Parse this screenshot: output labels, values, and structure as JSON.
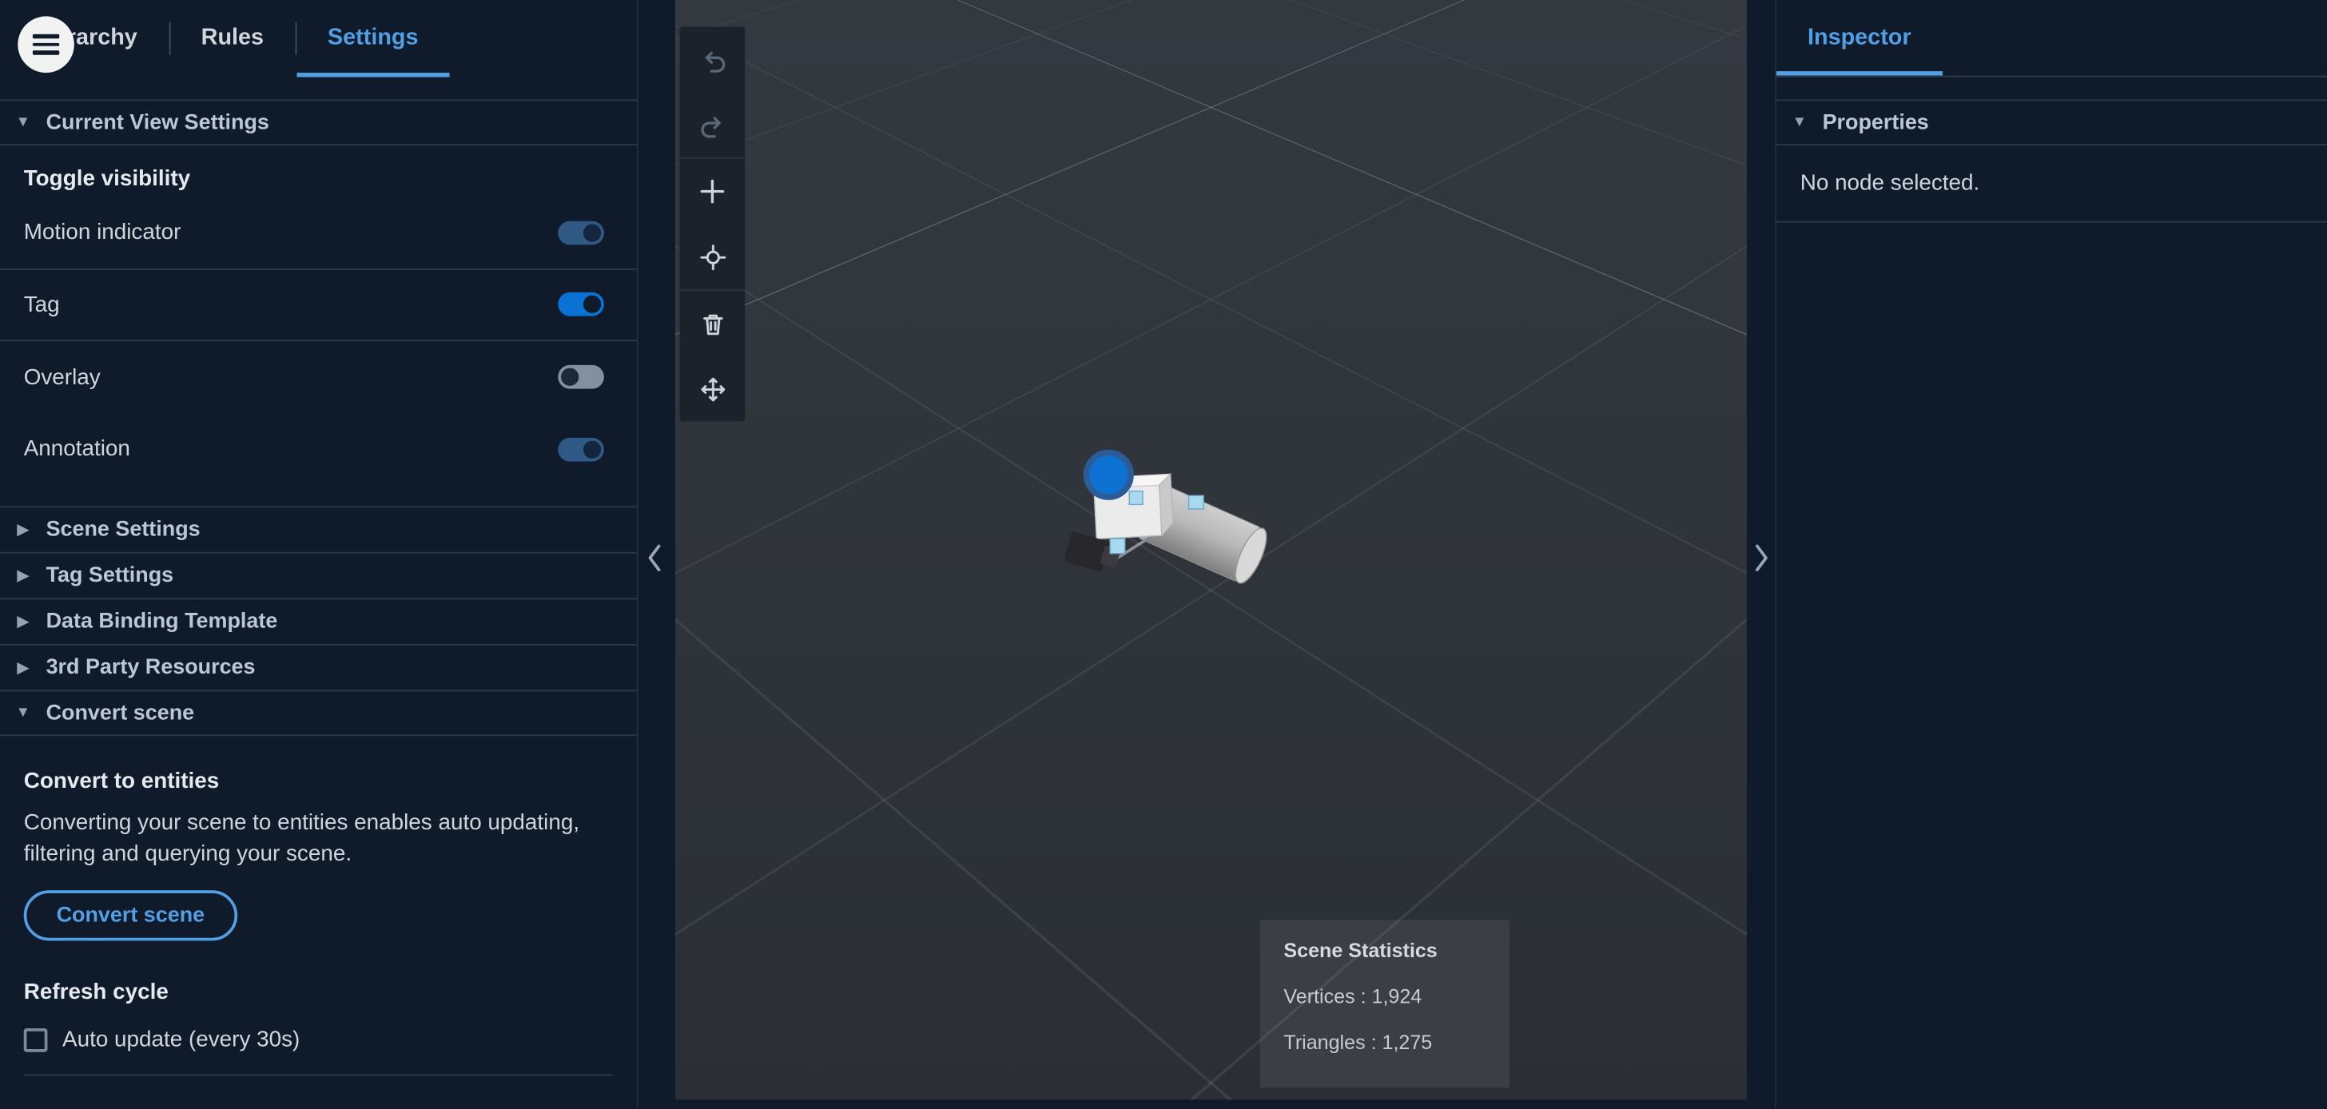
{
  "left_panel": {
    "tabs": [
      {
        "label": "Hierarchy"
      },
      {
        "label": "Rules"
      },
      {
        "label": "Settings"
      }
    ],
    "active_tab": "Settings",
    "current_view": {
      "title": "Current View Settings",
      "toggle_heading": "Toggle visibility",
      "toggles": [
        {
          "label": "Motion indicator",
          "state": "on-dimmed"
        },
        {
          "label": "Tag",
          "state": "on"
        },
        {
          "label": "Overlay",
          "state": "off"
        },
        {
          "label": "Annotation",
          "state": "on-dimmed"
        }
      ]
    },
    "collapsed_sections": [
      {
        "title": "Scene Settings"
      },
      {
        "title": "Tag Settings"
      },
      {
        "title": "Data Binding Template"
      },
      {
        "title": "3rd Party Resources"
      }
    ],
    "convert_scene": {
      "title": "Convert scene",
      "subheading": "Convert to entities",
      "description": "Converting your scene to entities enables auto updating, filtering and querying your scene.",
      "button_label": "Convert scene",
      "refresh_heading": "Refresh cycle",
      "checkbox_label": "Auto update (every 30s)",
      "checkbox_checked": false
    }
  },
  "viewport": {
    "toolbar_icons": [
      {
        "name": "undo-icon",
        "disabled": true
      },
      {
        "name": "redo-icon",
        "disabled": true
      },
      {
        "name": "add-object-icon",
        "disabled": false
      },
      {
        "name": "placement-target-icon",
        "disabled": false
      },
      {
        "name": "delete-icon",
        "disabled": false
      },
      {
        "name": "move-gizmo-icon",
        "disabled": false
      }
    ],
    "stats": {
      "title": "Scene Statistics",
      "vertices_label": "Vertices : 1,924",
      "triangles_label": "Triangles : 1,275",
      "vertices": 1924,
      "triangles": 1275
    }
  },
  "inspector": {
    "tab_label": "Inspector",
    "properties_title": "Properties",
    "empty_message": "No node selected."
  },
  "colors": {
    "accent_blue": "#539fe5",
    "toggle_on": "#0972d3",
    "panel_bg": "#0f1b2a",
    "viewport_bg": "#2f3338",
    "tag_marker_blue": "#0d72d2"
  }
}
